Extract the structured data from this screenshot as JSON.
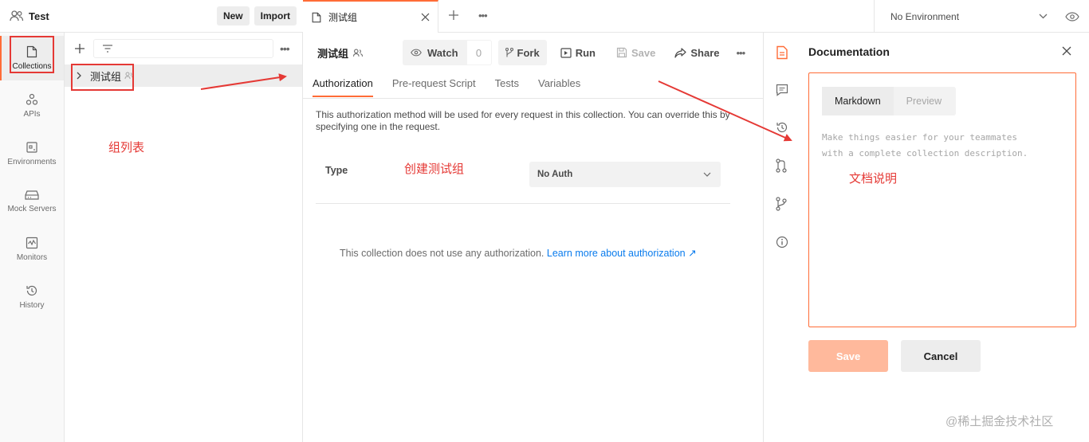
{
  "workspace": {
    "name": "Test",
    "new_label": "New",
    "import_label": "Import"
  },
  "left_nav": [
    {
      "label": "Collections",
      "icon": "collections-icon"
    },
    {
      "label": "APIs",
      "icon": "apis-icon"
    },
    {
      "label": "Environments",
      "icon": "environments-icon"
    },
    {
      "label": "Mock Servers",
      "icon": "mock-servers-icon"
    },
    {
      "label": "Monitors",
      "icon": "monitors-icon"
    },
    {
      "label": "History",
      "icon": "history-icon"
    }
  ],
  "sidebar": {
    "collection_name": "测试组"
  },
  "tabbar": {
    "tab_name": "测试组",
    "environment": "No Environment"
  },
  "main": {
    "title": "测试组",
    "watch_label": "Watch",
    "watch_count": "0",
    "fork_label": "Fork",
    "run_label": "Run",
    "save_label": "Save",
    "share_label": "Share",
    "tabs": [
      "Authorization",
      "Pre-request Script",
      "Tests",
      "Variables"
    ],
    "auth_description": "This authorization method will be used for every request in this collection. You can override this by specifying one in the request.",
    "type_label": "Type",
    "auth_value": "No Auth",
    "no_auth_text": "This collection does not use any authorization.",
    "learn_more": "Learn more about authorization ↗"
  },
  "docs": {
    "title": "Documentation",
    "tab_markdown": "Markdown",
    "tab_preview": "Preview",
    "placeholder_line1": "Make things easier for your teammates",
    "placeholder_line2": "with a complete collection description.",
    "save_label": "Save",
    "cancel_label": "Cancel"
  },
  "annotations": {
    "group_list": "组列表",
    "create_group": "创建测试组",
    "doc_desc": "文档说明",
    "color": "#e53935"
  },
  "watermark": "@稀土掘金技术社区",
  "colors": {
    "accent": "#ff6c37",
    "link": "#097bed",
    "annotation": "#e53935"
  }
}
